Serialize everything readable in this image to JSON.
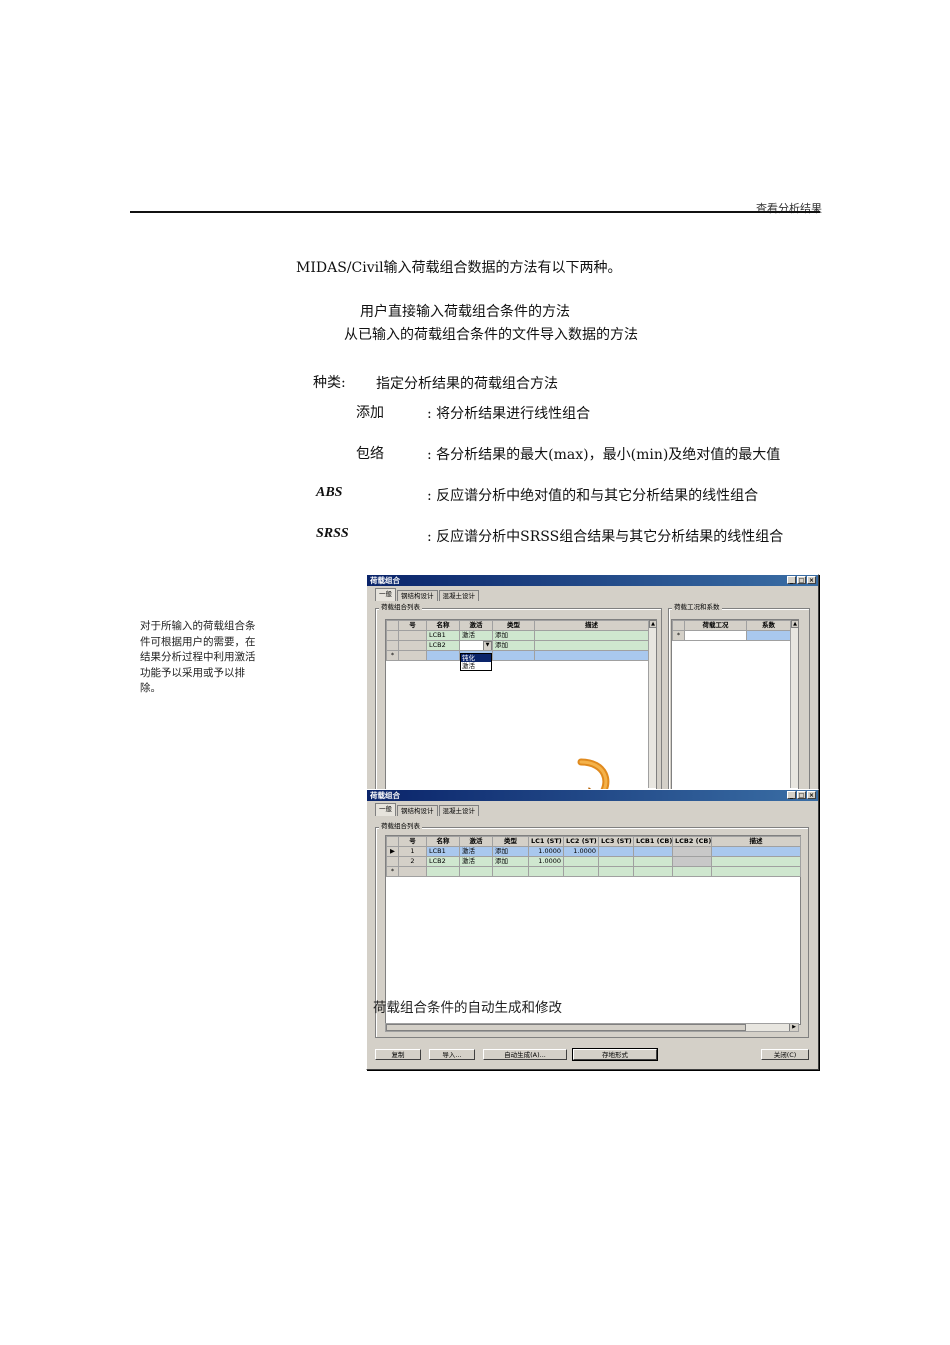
{
  "header": {
    "section": "查看分析结果"
  },
  "intro": {
    "line": "MIDAS/Civil输入荷载组合数据的方法有以下两种。",
    "method1": "用户直接输入荷载组合条件的方法",
    "method2": "从已输入的荷载组合条件的文件导入数据的方法"
  },
  "types": {
    "label": "种类:",
    "desc": "指定分析结果的荷载组合方法",
    "items": [
      {
        "name": "添加",
        "desc": ": 将分析结果进行线性组合"
      },
      {
        "name": "包络",
        "desc": ": 各分析结果的最大(max)，最小(min)及绝对值的最大值"
      },
      {
        "name": "ABS",
        "desc": ": 反应谱分析中绝对值的和与其它分析结果的线性组合"
      },
      {
        "name": "SRSS",
        "desc": ": 反应谱分析中SRSS组合结果与其它分析结果的线性组合"
      }
    ]
  },
  "side_note": "对于所输入的荷载组合条件可根据用户的需要，在结果分析过程中利用激活功能予以采用或予以排除。",
  "dialog1": {
    "title": "荷载组合",
    "tabs": [
      "一般",
      "钢结构设计",
      "混凝土设计"
    ],
    "group_list": "荷载组合列表",
    "group_cases": "荷载工况和系数",
    "columns": [
      "号",
      "名称",
      "激活",
      "类型",
      "描述"
    ],
    "rows": [
      {
        "name": "LCB1",
        "active": "激活",
        "type": "添加"
      },
      {
        "name": "LCB2",
        "active": "",
        "type": "添加"
      }
    ],
    "new_row_marker": "*",
    "dropdown_options": [
      "钝化",
      "激活"
    ],
    "case_columns": [
      "荷载工况",
      "系数"
    ]
  },
  "dialog2": {
    "title": "荷载组合",
    "tabs": [
      "一般",
      "钢结构设计",
      "混凝土设计"
    ],
    "group_list": "荷载组合列表",
    "columns": [
      "号",
      "名称",
      "激活",
      "类型",
      "LC1 (ST)",
      "LC2 (ST)",
      "LC3 (ST)",
      "LCB1 (CB)",
      "LCB2 (CB)",
      "描述"
    ],
    "rows": [
      {
        "marker": "▶",
        "no": "1",
        "name": "LCB1",
        "active": "激活",
        "type": "添加",
        "lc1": "1.0000",
        "lc2": "1.0000"
      },
      {
        "marker": "",
        "no": "2",
        "name": "LCB2",
        "active": "激活",
        "type": "添加",
        "lc1": "1.0000",
        "lc2": ""
      }
    ],
    "new_row_marker": "*",
    "buttons": {
      "copy": "复制",
      "import": "导入...",
      "auto": "自动生成(A)...",
      "spreadsheet": "存地形式",
      "close": "关闭(C)"
    }
  },
  "figure_caption": "荷载组合条件的自动生成和修改"
}
